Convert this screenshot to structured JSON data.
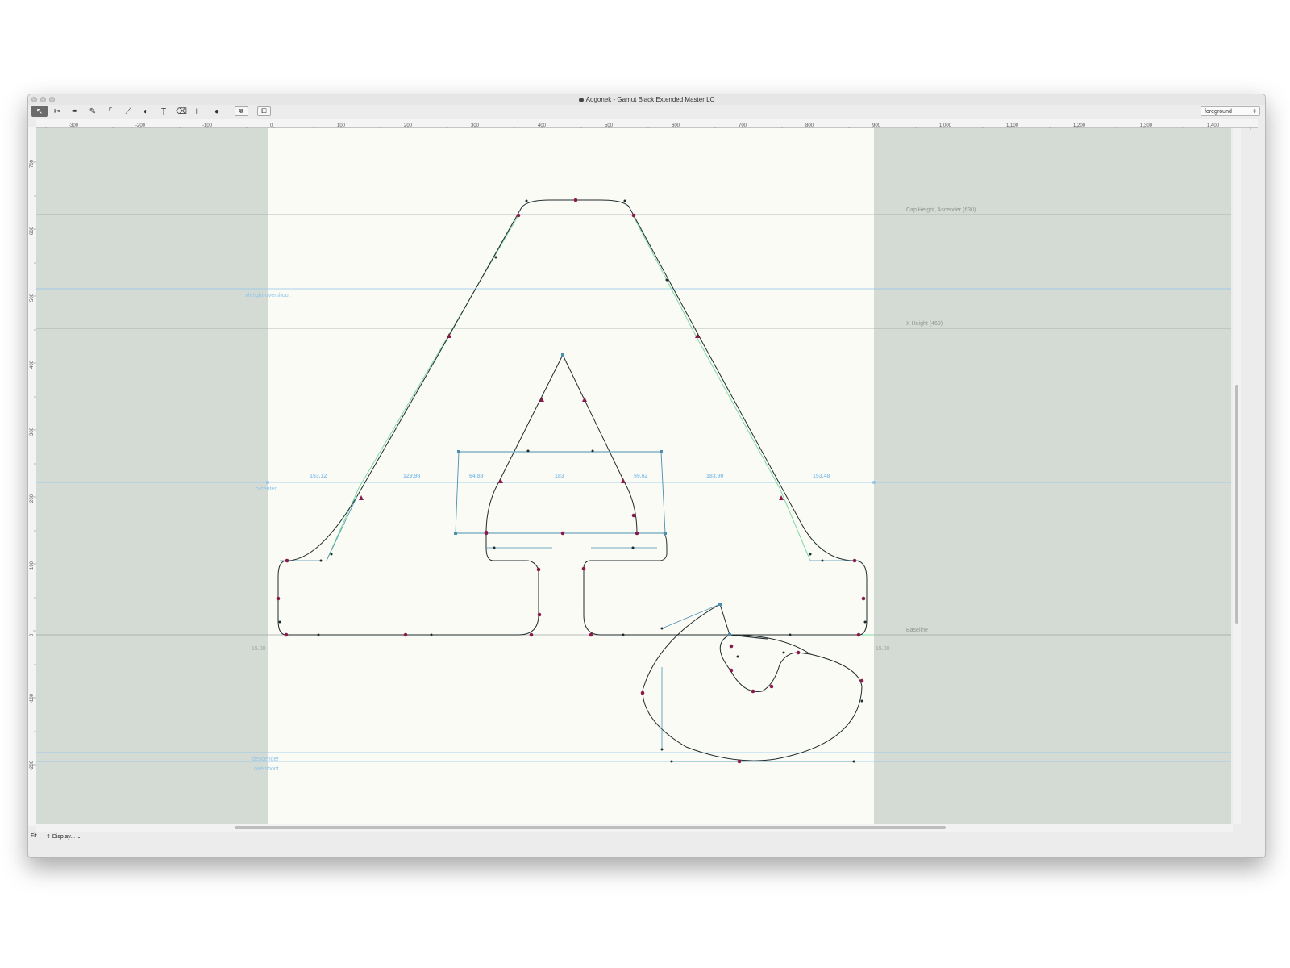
{
  "window": {
    "title": "Aogonek - Gamut Black Extended Master LC",
    "layer": "foreground"
  },
  "toolbar": {
    "tools": [
      "pointer-tool",
      "knife-tool",
      "pen-tool",
      "draw-tool",
      "corner-tool",
      "line-tool",
      "shape-tool",
      "text-tool",
      "eraser-tool",
      "measure-tool",
      "fill-tool",
      "pair-tool",
      "copy-tool"
    ]
  },
  "ruler": {
    "h_ticks": [
      "-300",
      "-200",
      "-100",
      "0",
      "100",
      "200",
      "300",
      "400",
      "500",
      "600",
      "700",
      "800",
      "900",
      "1,000",
      "1,100",
      "1,200",
      "1,300",
      "1,400"
    ],
    "v_ticks": [
      "700",
      "600",
      "500",
      "400",
      "300",
      "200",
      "100",
      "0",
      "-100",
      "-200"
    ]
  },
  "guides": {
    "cap_height": "Cap Height, Ascender (630)",
    "x_height": "X Height (460)",
    "baseline": "Baseline",
    "xheight_overshoot": "xheight-overshoot",
    "o_center": "o-center",
    "descender": "descender",
    "overshoot": "overshoot"
  },
  "measurements": [
    "153.12",
    "129.98",
    "64.89",
    "183",
    "59.62",
    "183.90",
    "153.48"
  ],
  "sidebearings": {
    "left": "15.00",
    "right": "15.00"
  },
  "colors": {
    "canvas_bg": "#d4dbd5",
    "glyph_area": "#fbfbf6",
    "guide_blue": "#8ec5ea",
    "metric_line": "#9da6a3",
    "outline": "#1f2b2b",
    "oncurve": "#8a1a4a",
    "handle": "#4a8fb0",
    "background_outline": "#7ed9a0"
  },
  "status": {
    "zoom": "Fit",
    "display": "Display..."
  }
}
